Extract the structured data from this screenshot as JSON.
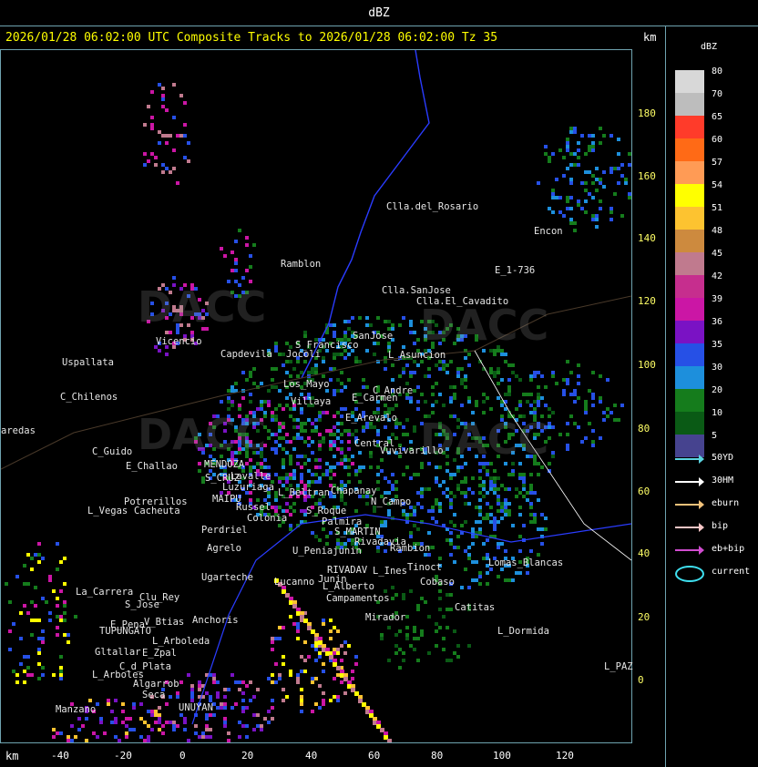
{
  "window": {
    "title": "dBZ"
  },
  "header": {
    "text": "2026/01/28 06:02:00 UTC Composite Tracks to 2026/01/28 06:02:00 Tz 35"
  },
  "axes": {
    "unit_top": "km",
    "unit_bottom": "km",
    "y_ticks": [
      "180",
      "160",
      "140",
      "120",
      "100",
      "80",
      "60",
      "40",
      "20",
      "0"
    ],
    "x_ticks": [
      "-40",
      "-20",
      "0",
      "20",
      "40",
      "60",
      "80",
      "100",
      "120"
    ]
  },
  "scale": {
    "title": "dBZ",
    "levels": [
      {
        "label": "80",
        "color": "#d8d8d8"
      },
      {
        "label": "70",
        "color": "#bdbdbd"
      },
      {
        "label": "65",
        "color": "#ff3b2a"
      },
      {
        "label": "60",
        "color": "#ff6a16"
      },
      {
        "label": "57",
        "color": "#ff9b55"
      },
      {
        "label": "54",
        "color": "#ffff00"
      },
      {
        "label": "51",
        "color": "#fdc330"
      },
      {
        "label": "48",
        "color": "#cd8a3e"
      },
      {
        "label": "45",
        "color": "#c07a8e"
      },
      {
        "label": "42",
        "color": "#c62e8e"
      },
      {
        "label": "39",
        "color": "#cb16a5"
      },
      {
        "label": "36",
        "color": "#7a12c4"
      },
      {
        "label": "35",
        "color": "#2650e6"
      },
      {
        "label": "30",
        "color": "#1d8fdc"
      },
      {
        "label": "20",
        "color": "#157c1c"
      },
      {
        "label": "10",
        "color": "#0a5a15"
      },
      {
        "label": "5",
        "color": "#46438f"
      }
    ]
  },
  "legend": [
    {
      "label": "50YD",
      "color": "#5bd3e0"
    },
    {
      "label": "30HM",
      "color": "#ffffff"
    },
    {
      "label": "eburn",
      "color": "#f2c27a"
    },
    {
      "label": "bip",
      "color": "#f6c6c6"
    },
    {
      "label": "eb+bip",
      "color": "#d14cd0"
    },
    {
      "label": "current",
      "color": "#3fe0f0"
    }
  ],
  "watermarks": [
    "DACC",
    "DACC",
    "DACC",
    "DACC"
  ],
  "places": [
    "Clla.del_Rosario",
    "Encon",
    "E_1-736",
    "Ramblon",
    "Clla.SanJose",
    "Clla.El_Cavadito",
    "SanJose",
    "S_Francisco",
    "L_Asuncion",
    "Uspallata",
    "Vicencio",
    "Capdevila",
    "Jocoli",
    "Los_Mayo",
    "Villaya",
    "E_Carmen",
    "C_Andre",
    "C_Chilenos",
    "E_Arevalo",
    "Central",
    "Vuvivarillo",
    "aredas",
    "C_Guido",
    "E_Challao",
    "MENDOZA",
    "Lavalle",
    "S_CRUZ",
    "Luzuriaga",
    "L_Beltran",
    "Chapanay",
    "N_Campo",
    "Potrerillos",
    "L_Vegas",
    "Cacheuta",
    "MAIPU",
    "Russel",
    "Colonia",
    "Perdriel",
    "Agrelo",
    "S_Roque",
    "Palmira",
    "S_MARTIN",
    "Rivadavia",
    "Rambion",
    "Lomas_Blancas",
    "U_Peniajunin",
    "Ugarteche",
    "Lucanno",
    "RIVADAV",
    "L_Ines",
    "Tinoct",
    "Junin",
    "Cobaso",
    "La_Carrera",
    "Clu_Rey",
    "S_Jose",
    "L_Alberto",
    "Campamentos",
    "Catitas",
    "Mirador",
    "Anchoris",
    "E_Pena",
    "V_Btias",
    "TUPUNGATO",
    "L_Arboleda",
    "L_Dormida",
    "Gltallar",
    "E_Zpal",
    "C_d_Plata",
    "L_PAZ",
    "L_Arboles",
    "Algarrob",
    "Seca",
    "Manzano",
    "UNUYAN"
  ]
}
